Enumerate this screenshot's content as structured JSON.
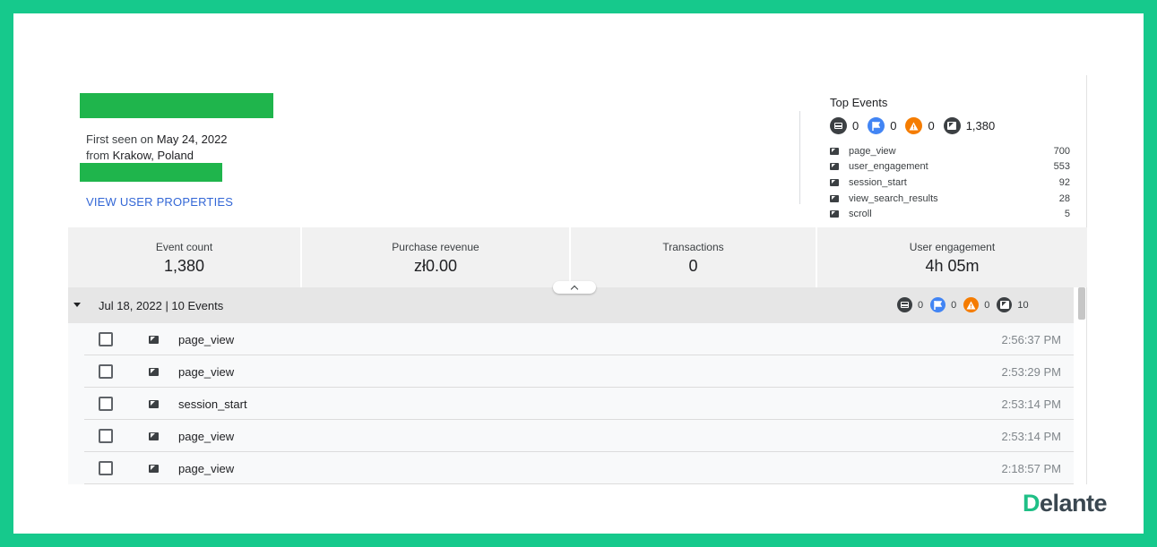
{
  "user": {
    "first_seen_prefix": "First seen on ",
    "first_seen_date": "May 24, 2022",
    "from_prefix": "from ",
    "location": "Krakow, Poland",
    "view_properties": "VIEW USER PROPERTIES"
  },
  "top_events": {
    "title": "Top Events",
    "badges": [
      {
        "icon": "window-icon",
        "count": "0",
        "color": "#3c4043"
      },
      {
        "icon": "flag-icon",
        "count": "0",
        "color": "#4285f4"
      },
      {
        "icon": "warning-icon",
        "count": "0",
        "color": "#f57c00"
      },
      {
        "icon": "cursor-icon",
        "count": "1,380",
        "color": "#3c4043"
      }
    ],
    "items": [
      {
        "name": "page_view",
        "count": "700"
      },
      {
        "name": "user_engagement",
        "count": "553"
      },
      {
        "name": "session_start",
        "count": "92"
      },
      {
        "name": "view_search_results",
        "count": "28"
      },
      {
        "name": "scroll",
        "count": "5"
      }
    ]
  },
  "metrics": [
    {
      "label": "Event count",
      "value": "1,380"
    },
    {
      "label": "Purchase revenue",
      "value": "zł0.00"
    },
    {
      "label": "Transactions",
      "value": "0"
    },
    {
      "label": "User engagement",
      "value": "4h 05m"
    }
  ],
  "day": {
    "title": "Jul 18, 2022 | 10 Events",
    "badges": [
      {
        "icon": "window-icon",
        "count": "0"
      },
      {
        "icon": "flag-icon",
        "count": "0"
      },
      {
        "icon": "warning-icon",
        "count": "0"
      },
      {
        "icon": "cursor-icon",
        "count": "10"
      }
    ]
  },
  "events": [
    {
      "name": "page_view",
      "time": "2:56:37 PM"
    },
    {
      "name": "page_view",
      "time": "2:53:29 PM"
    },
    {
      "name": "session_start",
      "time": "2:53:14 PM"
    },
    {
      "name": "page_view",
      "time": "2:53:14 PM"
    },
    {
      "name": "page_view",
      "time": "2:18:57 PM"
    }
  ],
  "brand": {
    "logo_initial": "D",
    "logo_rest": "elante",
    "accent": "#16c98c"
  }
}
